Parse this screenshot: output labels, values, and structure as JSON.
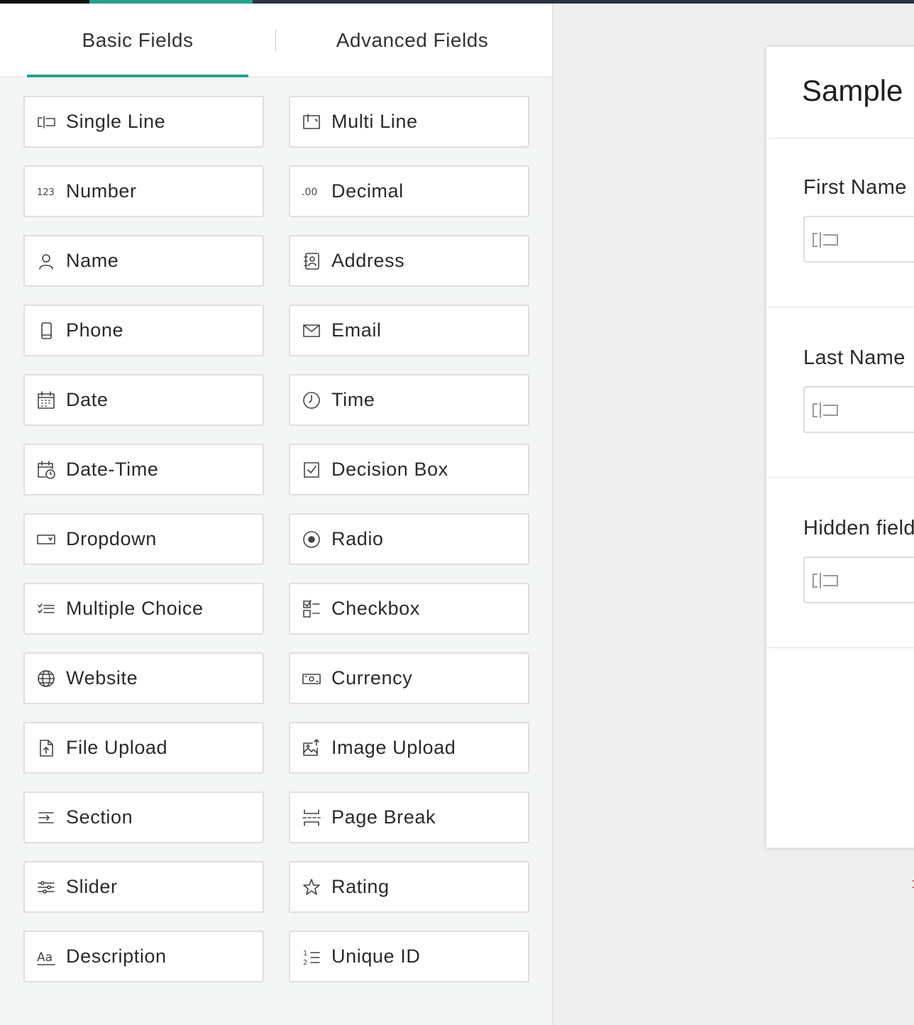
{
  "tabs": {
    "basic": "Basic Fields",
    "advanced": "Advanced Fields"
  },
  "fields": [
    {
      "label": "Single Line",
      "icon": "single-line-icon"
    },
    {
      "label": "Multi Line",
      "icon": "multi-line-icon"
    },
    {
      "label": "Number",
      "icon": "number-icon"
    },
    {
      "label": "Decimal",
      "icon": "decimal-icon"
    },
    {
      "label": "Name",
      "icon": "person-icon"
    },
    {
      "label": "Address",
      "icon": "address-book-icon"
    },
    {
      "label": "Phone",
      "icon": "phone-icon"
    },
    {
      "label": "Email",
      "icon": "envelope-icon"
    },
    {
      "label": "Date",
      "icon": "calendar-icon"
    },
    {
      "label": "Time",
      "icon": "clock-icon"
    },
    {
      "label": "Date-Time",
      "icon": "calendar-clock-icon"
    },
    {
      "label": "Decision Box",
      "icon": "checked-box-icon"
    },
    {
      "label": "Dropdown",
      "icon": "dropdown-icon"
    },
    {
      "label": "Radio",
      "icon": "radio-icon"
    },
    {
      "label": "Multiple Choice",
      "icon": "multiple-choice-icon"
    },
    {
      "label": "Checkbox",
      "icon": "checkbox-list-icon"
    },
    {
      "label": "Website",
      "icon": "globe-icon"
    },
    {
      "label": "Currency",
      "icon": "banknote-icon"
    },
    {
      "label": "File Upload",
      "icon": "file-upload-icon"
    },
    {
      "label": "Image Upload",
      "icon": "image-upload-icon"
    },
    {
      "label": "Section",
      "icon": "section-icon"
    },
    {
      "label": "Page Break",
      "icon": "page-break-icon"
    },
    {
      "label": "Slider",
      "icon": "slider-icon"
    },
    {
      "label": "Rating",
      "icon": "star-icon"
    },
    {
      "label": "Description",
      "icon": "text-aa-icon"
    },
    {
      "label": "Unique ID",
      "icon": "numbered-list-icon"
    }
  ],
  "form": {
    "title": "Sample I",
    "fields": [
      {
        "label": "First Name"
      },
      {
        "label": "Last Name"
      },
      {
        "label": "Hidden field"
      }
    ]
  },
  "colors": {
    "accent": "#2aa18f",
    "panel_bg": "#f4f5f5",
    "canvas_bg": "#efefef",
    "top_bar": "#2c3245"
  }
}
